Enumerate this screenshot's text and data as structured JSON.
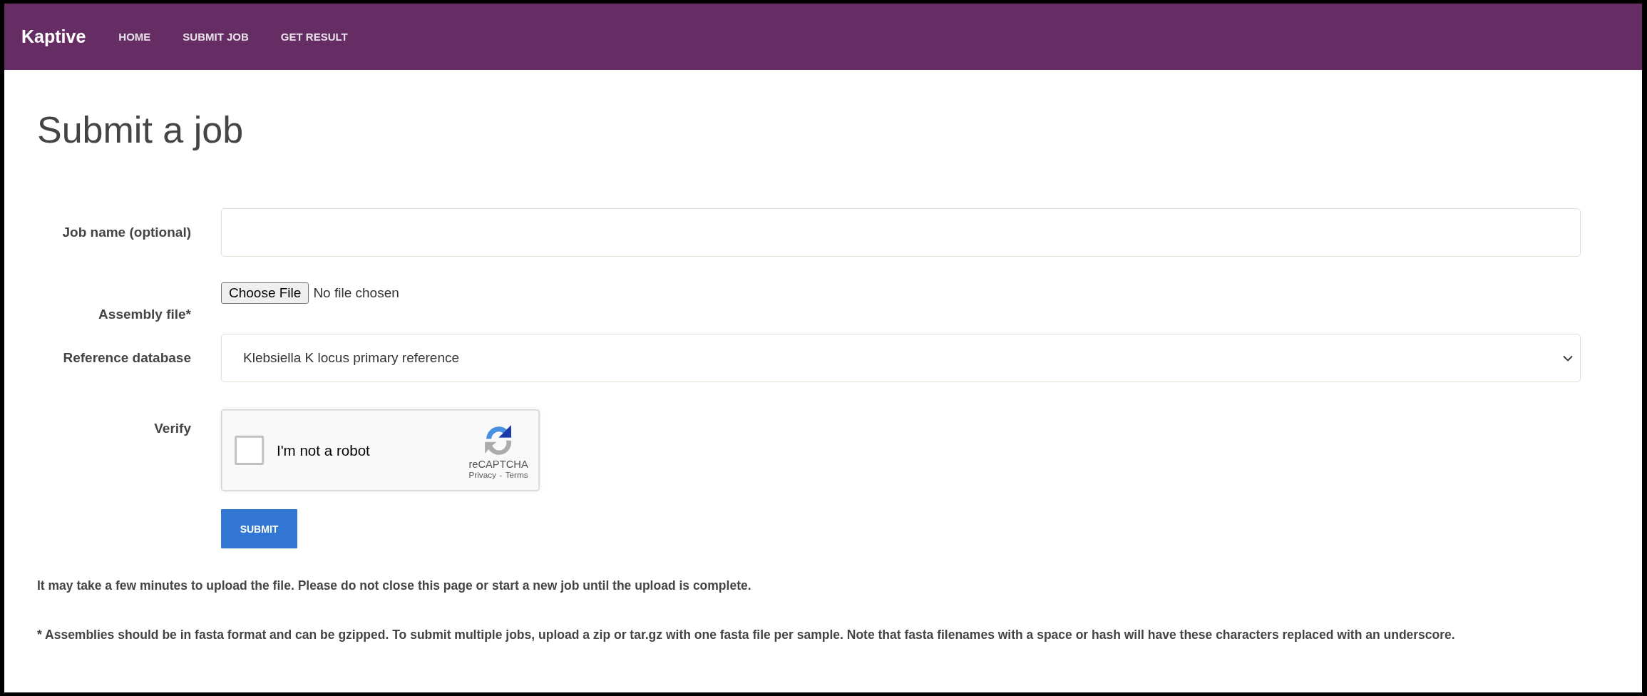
{
  "navbar": {
    "brand": "Kaptive",
    "links": [
      "HOME",
      "SUBMIT JOB",
      "GET RESULT"
    ]
  },
  "title": "Submit a job",
  "form": {
    "fields": [
      {
        "kind": "text",
        "label": "Job name (optional)"
      },
      {
        "kind": "file",
        "label": "Assembly file*",
        "button": "Choose File",
        "status": "No file chosen"
      },
      {
        "kind": "select",
        "label": "Reference database",
        "value": "Klebsiella K locus primary reference"
      },
      {
        "kind": "captcha",
        "label": "Verify",
        "text": "I'm not a robot",
        "checked": false,
        "brand": "reCAPTCHA",
        "links": [
          "Privacy",
          "Terms"
        ],
        "separator": "-"
      }
    ],
    "submit": "SUBMIT"
  },
  "notes": [
    "It may take a few minutes to upload the file. Please do not close this page or start a new job until the upload is complete.",
    "* Assemblies should be in fasta format and can be gzipped. To submit multiple jobs, upload a zip or tar.gz with one fasta file per sample. Note that fasta filenames with a space or hash will have these characters replaced with an underscore."
  ]
}
